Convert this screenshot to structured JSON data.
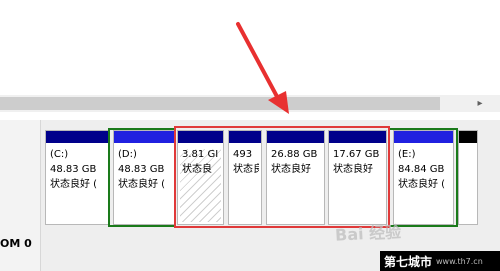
{
  "scrollbar": {
    "right_arrow": "▸"
  },
  "disk": {
    "label": "OM 0"
  },
  "partitions": [
    {
      "name": "(C:)",
      "size": "48.83 GB",
      "status": "状态良好 ("
    },
    {
      "name": "(D:)",
      "size": "48.83 GB",
      "status": "状态良好 ("
    },
    {
      "name": "",
      "size": "3.81 GI",
      "status": "状态良"
    },
    {
      "name": "",
      "size": "493",
      "status": "状态良"
    },
    {
      "name": "",
      "size": "26.88 GB",
      "status": "状态良好"
    },
    {
      "name": "",
      "size": "17.67 GB",
      "status": "状态良好"
    },
    {
      "name": "(E:)",
      "size": "84.84 GB",
      "status": "状态良好 ("
    },
    {
      "name": "",
      "size": "",
      "status": ""
    }
  ],
  "colors": {
    "unallocated_bar": "#00008b",
    "primary_bar": "#2020e0",
    "highlight_red": "#e03a3a",
    "highlight_green": "#1a7a1a"
  },
  "watermark": {
    "text": "Bai 经验"
  },
  "site_badge": {
    "cn": "第七城市",
    "url": "www.th7.cn"
  }
}
